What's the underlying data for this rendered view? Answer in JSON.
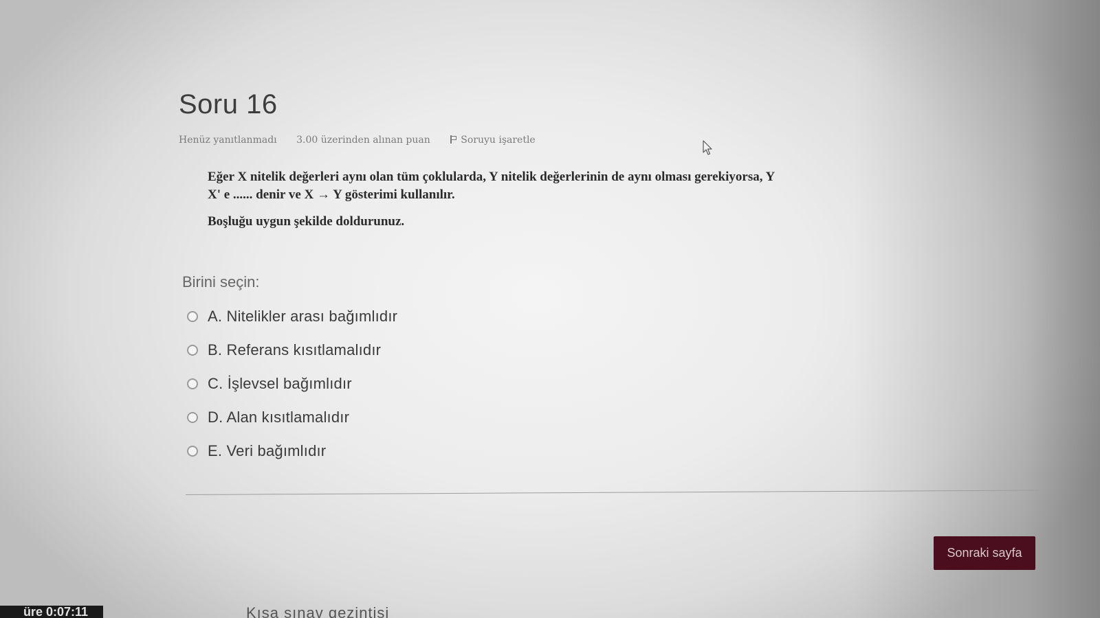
{
  "question": {
    "title": "Soru 16",
    "status": "Henüz yanıtlanmadı",
    "points": "3.00 üzerinden alınan puan",
    "flag_label": "Soruyu işaretle",
    "text_line1": "Eğer X nitelik değerleri aynı olan tüm çoklularda, Y nitelik değerlerinin de aynı olması gerekiyorsa, Y",
    "text_line2": "X' e ...... denir ve X → Y gösterimi kullanılır.",
    "instruction": "Boşluğu uygun şekilde doldurunuz."
  },
  "answers": {
    "prompt": "Birini seçin:",
    "options": [
      "A. Nitelikler arası bağımlıdır",
      "B. Referans kısıtlamalıdır",
      "C. İşlevsel bağımlıdır",
      "D. Alan kısıtlamalıdır",
      "E. Veri bağımlıdır"
    ]
  },
  "navigation": {
    "next_label": "Sonraki sayfa",
    "timer": "üre 0:07:11",
    "quiz_nav": "Kısa sınav gezintisi"
  },
  "colors": {
    "next_button_bg": "#4a0e1e",
    "page_bg": "#ececec"
  }
}
